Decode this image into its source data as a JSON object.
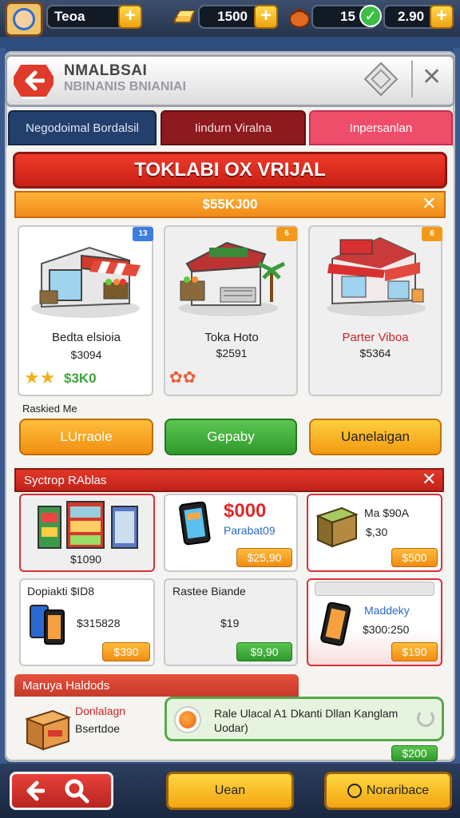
{
  "topbar": {
    "player_name": "Teoa",
    "gold": "1500",
    "progress": "15",
    "gems": "2.90"
  },
  "header": {
    "title": "NMALBSAI",
    "subtitle": "NBINANIS BNIANIAI"
  },
  "tabs": [
    {
      "label": "Negodoimal Bordalsil"
    },
    {
      "label": "Iindurn Viralna"
    },
    {
      "label": "Inpersanlan"
    }
  ],
  "main": {
    "ribbon_title": "TOKLABI OX VRIJAL",
    "price_bar": "$55KJ00",
    "rank_label": "Raskied Me"
  },
  "stores": [
    {
      "name": "Bedta elsioia",
      "price": "$3094",
      "rating_value": "$3K0",
      "badge": "13",
      "button": "LUrraole"
    },
    {
      "name": "Toka Hoto",
      "price": "$2591",
      "badge": "6",
      "button": "Gepaby"
    },
    {
      "name": "Parter Viboa",
      "price": "$5364",
      "badge": "6",
      "button": "Uanelaigan"
    }
  ],
  "section2": {
    "title": "Syctrop RAblas",
    "items": [
      {
        "label": "$1090"
      },
      {
        "headline": "$000",
        "label": "Parabat09",
        "price": "$25,90"
      },
      {
        "headline": "Ma $90A",
        "label": "$,30",
        "price": "$500"
      },
      {
        "headline": "Dopiakti $ID8",
        "label": "$315828",
        "price": "$390"
      },
      {
        "headline": "Rastee Biande",
        "label": "$19",
        "price": "$9,90"
      },
      {
        "headline": "Maddeky",
        "label": "$300:250",
        "price": "$190"
      }
    ]
  },
  "section3": {
    "title": "Maruya Haldods",
    "item_name": "Donlalagn",
    "item_sub": "Bsertdoe",
    "notification": "Rale Ulacal A1 Dkanti Dllan Kanglam Uodar)",
    "price": "$200"
  },
  "nav": {
    "btn_middle": "Uean",
    "btn_right": "Noraribace"
  },
  "colors": {
    "accent_red": "#e03a2a",
    "accent_orange": "#f08e12",
    "accent_green": "#2f9a2b",
    "tab_active": "#ef4e6b"
  }
}
